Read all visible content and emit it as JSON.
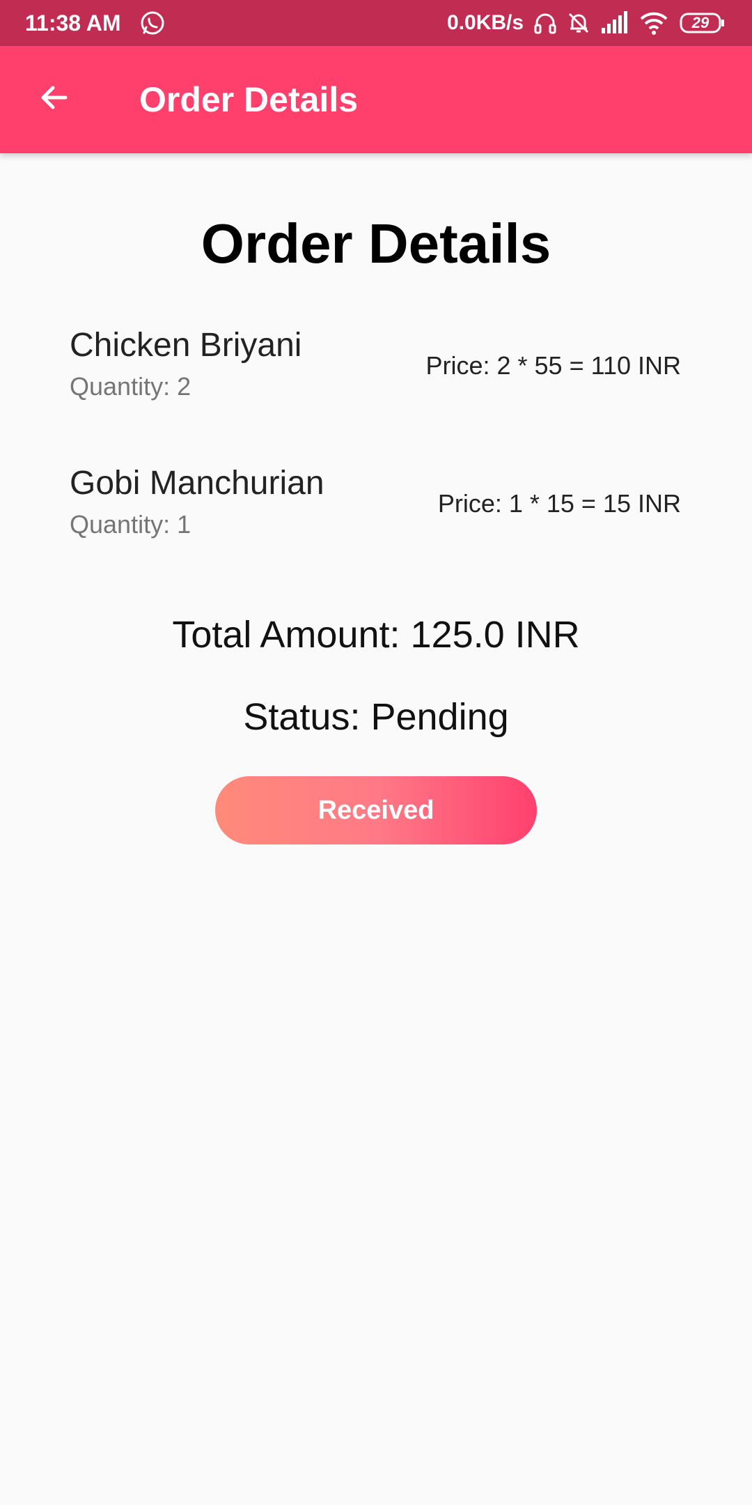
{
  "status_bar": {
    "time": "11:38 AM",
    "speed": "0.0KB/s",
    "battery": "29",
    "icons": [
      "whatsapp-icon",
      "headphones-icon",
      "bell-off-icon",
      "signal-icon",
      "wifi-icon",
      "battery-icon"
    ]
  },
  "app_bar": {
    "title": "Order Details",
    "back_icon": "arrow-back-icon"
  },
  "page": {
    "heading": "Order Details",
    "items": [
      {
        "name": "Chicken Briyani",
        "quantity": "Quantity: 2",
        "price": "Price: 2 * 55 = 110 INR"
      },
      {
        "name": "Gobi Manchurian",
        "quantity": "Quantity: 1",
        "price": "Price: 1 * 15 = 15 INR"
      }
    ],
    "total": "Total Amount: 125.0 INR",
    "status": "Status: Pending",
    "button_label": "Received"
  },
  "colors": {
    "status_bar": "#c02c52",
    "app_bar": "#ff3f6c",
    "background": "#fafafa",
    "button_gradient_start": "#ff8a7a",
    "button_gradient_end": "#ff406f"
  }
}
